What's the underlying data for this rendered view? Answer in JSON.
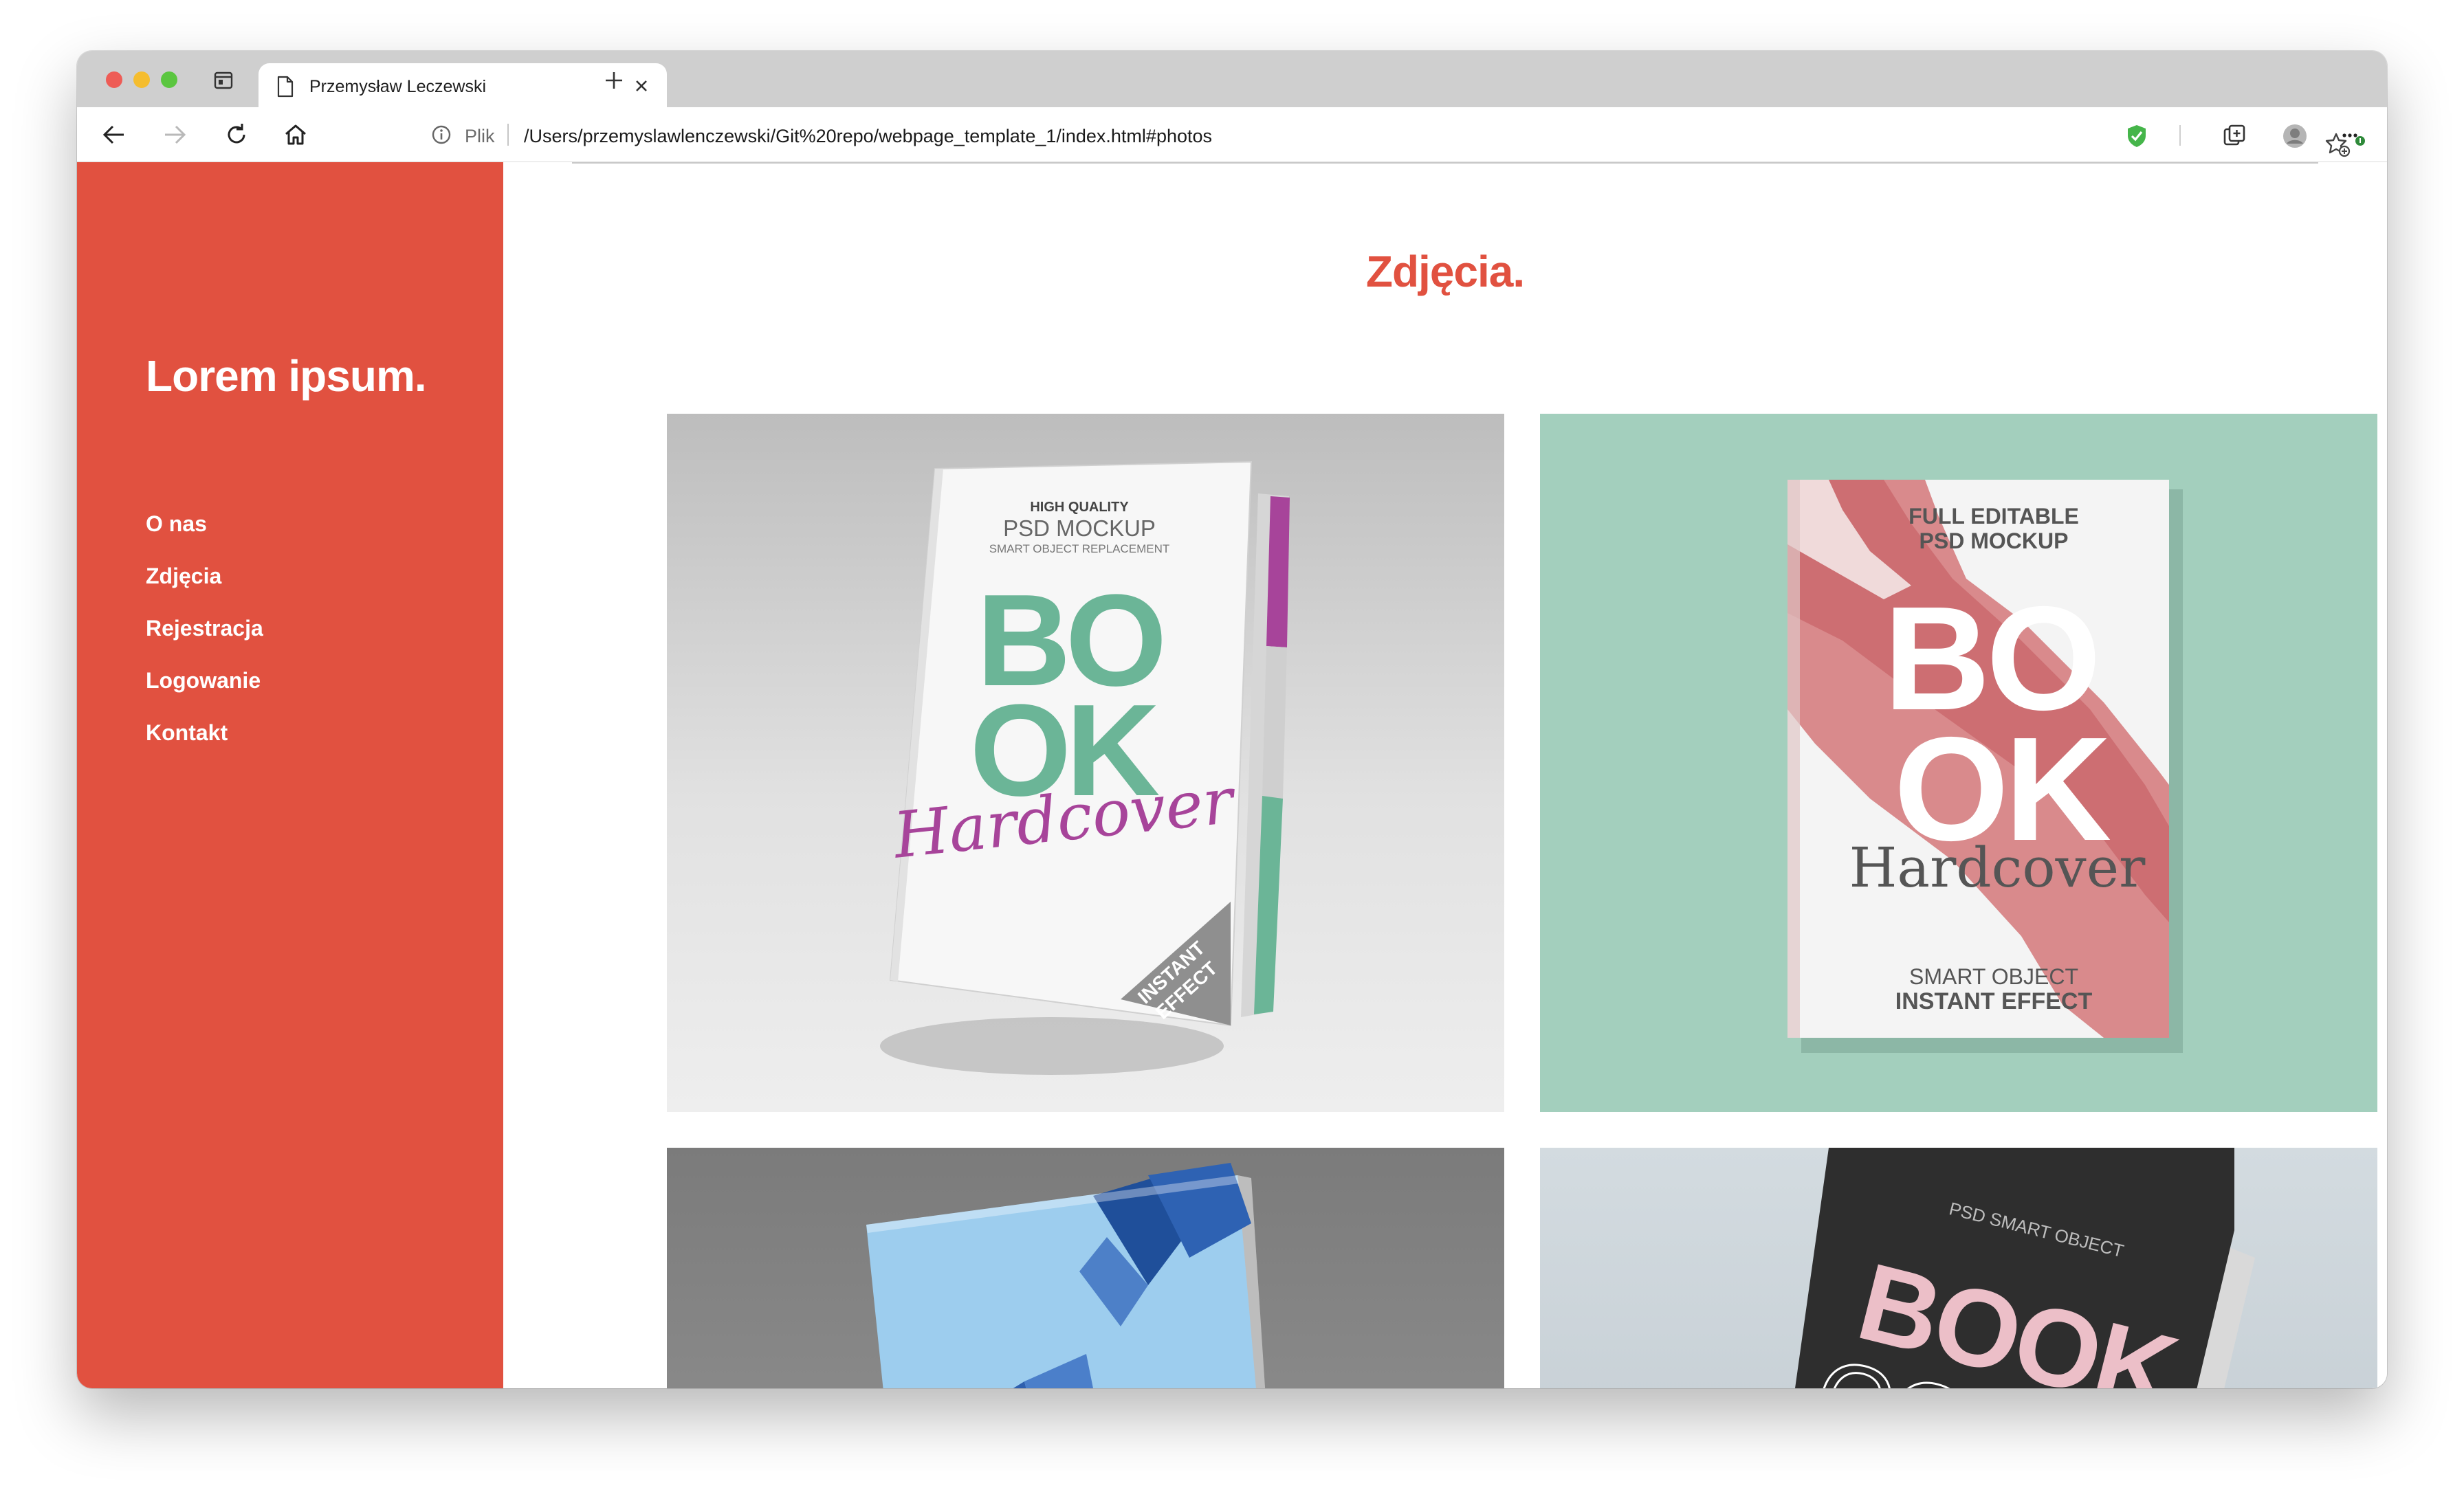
{
  "browser": {
    "tab_title": "Przemysław Leczewski",
    "url_prefix": "Plik",
    "url": "/Users/przemyslawlenczewski/Git%20repo/webpage_template_1/index.html#photos"
  },
  "sidebar": {
    "logo": "Lorem ipsum.",
    "menu": [
      "O nas",
      "Zdjęcia",
      "Rejestracja",
      "Logowanie",
      "Kontakt"
    ]
  },
  "main": {
    "heading": "Zdjęcia."
  },
  "photos": [
    {
      "line1": "HIGH QUALITY",
      "line2": "PSD MOCKUP",
      "line3": "SMART OBJECT REPLACEMENT",
      "big1": "BO",
      "big2": "OK",
      "script": "Hardcover",
      "corner1": "INSTANT",
      "corner2": "EFFECT"
    },
    {
      "line1": "FULL EDITABLE",
      "line2": "PSD MOCKUP",
      "big1": "BO",
      "big2": "OK",
      "script": "Hardcover",
      "line3": "SMART OBJECT",
      "line4": "INSTANT EFFECT"
    },
    {},
    {
      "line1": "PSD SMART OBJECT",
      "big1": "BOOK",
      "big2": "COVER"
    }
  ],
  "colors": {
    "accent": "#e15140",
    "mint": "#a3cfbd",
    "book_green": "#6bb597",
    "book_purple": "#a7449a",
    "book_pink": "#ecbfc8"
  }
}
